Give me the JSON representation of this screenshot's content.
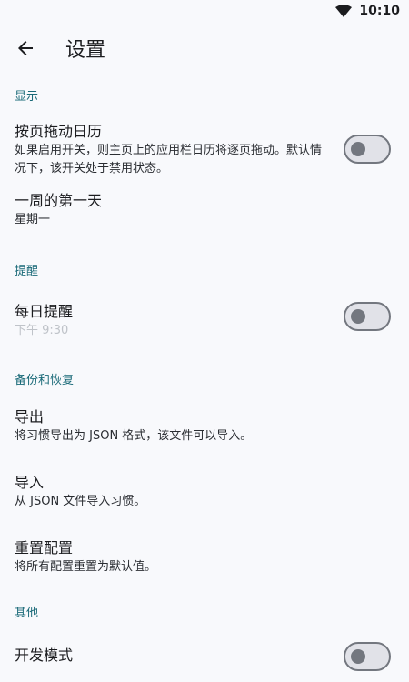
{
  "status_bar": {
    "time": "10:10"
  },
  "app_bar": {
    "title": "设置"
  },
  "sections": {
    "display": {
      "header": "显示",
      "swipe_calendar": {
        "title": "按页拖动日历",
        "summary": "如果启用开关，则主页上的应用栏日历将逐页拖动。默认情况下，该开关处于禁用状态。",
        "enabled": false
      },
      "first_day": {
        "title": "一周的第一天",
        "summary": "星期一"
      }
    },
    "reminders": {
      "header": "提醒",
      "daily": {
        "title": "每日提醒",
        "summary": "下午 9:30",
        "enabled": false
      }
    },
    "backup": {
      "header": "备份和恢复",
      "export": {
        "title": "导出",
        "summary": "将习惯导出为 JSON 格式，该文件可以导入。"
      },
      "import": {
        "title": "导入",
        "summary": "从 JSON 文件导入习惯。"
      },
      "reset": {
        "title": "重置配置",
        "summary": "将所有配置重置为默认值。"
      }
    },
    "other": {
      "header": "其他",
      "developer": {
        "title": "开发模式",
        "enabled": false
      }
    }
  },
  "colors": {
    "accent": "#1a6a78",
    "switch_outline": "#73777f",
    "switch_track": "#e1e2e8",
    "background": "#f8f9fc"
  },
  "icons": {
    "back": "arrow-back-icon",
    "wifi": "wifi-icon"
  }
}
